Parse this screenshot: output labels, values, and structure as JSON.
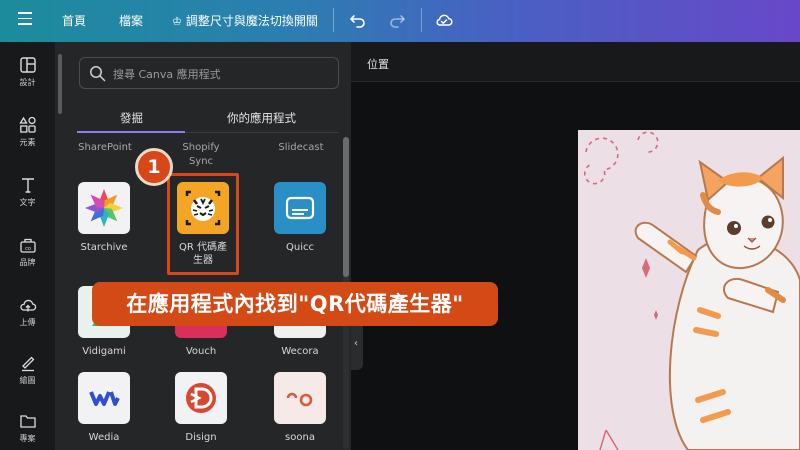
{
  "topbar": {
    "home": "首頁",
    "file": "檔案",
    "resize": "調整尺寸與魔法切換開關"
  },
  "rail": [
    {
      "label": "設計",
      "icon": "layout-icon"
    },
    {
      "label": "元素",
      "icon": "elements-icon"
    },
    {
      "label": "文字",
      "icon": "text-icon"
    },
    {
      "label": "品牌",
      "icon": "brand-icon"
    },
    {
      "label": "上傳",
      "icon": "upload-icon"
    },
    {
      "label": "繪圖",
      "icon": "draw-icon"
    },
    {
      "label": "專案",
      "icon": "folder-icon"
    }
  ],
  "search": {
    "placeholder": "搜尋 Canva 應用程式"
  },
  "tabs": [
    {
      "label": "發掘",
      "active": true
    },
    {
      "label": "你的應用程式",
      "active": false
    }
  ],
  "section_labels": [
    "SharePoint",
    "Shopify\nSync",
    "Slidecast"
  ],
  "apps": [
    {
      "name": "Starchive"
    },
    {
      "name": "QR 代碼產\n生器"
    },
    {
      "name": "Quicc"
    },
    {
      "name": "Vidigami"
    },
    {
      "name": "Vouch"
    },
    {
      "name": "Wecora"
    },
    {
      "name": "Wedia"
    },
    {
      "name": "Disign"
    },
    {
      "name": "soona"
    }
  ],
  "step": "1",
  "banner": "在應用程式內找到\"QR代碼產生器\"",
  "canvas": {
    "position_label": "位置"
  },
  "colors": {
    "accent": "#d8471a",
    "tab_underline": "#8b7cf0"
  }
}
